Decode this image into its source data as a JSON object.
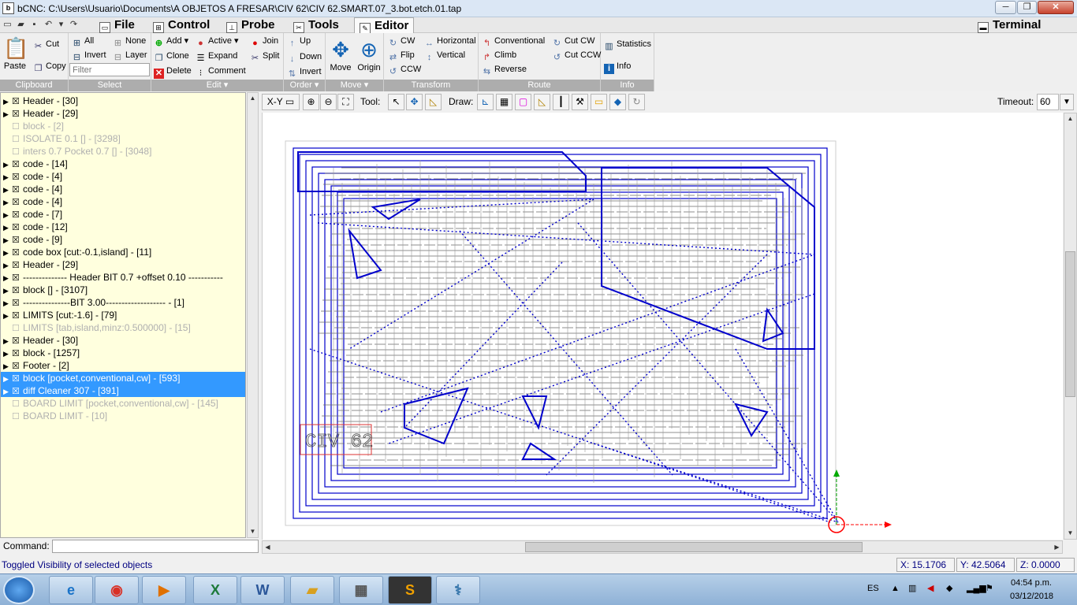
{
  "window": {
    "title": "bCNC: C:\\Users\\Usuario\\Documents\\A OBJETOS A FRESAR\\CIV 62\\CIV 62.SMART.07_3.bot.etch.01.tap",
    "app_icon": "bcnc-app-icon",
    "minimize": "─",
    "maximize": "❐",
    "close": "✕"
  },
  "menu": {
    "tabs": [
      {
        "label": "File",
        "icon": "file-icon"
      },
      {
        "label": "Control",
        "icon": "control-icon"
      },
      {
        "label": "Probe",
        "icon": "probe-icon"
      },
      {
        "label": "Tools",
        "icon": "tools-icon"
      },
      {
        "label": "Editor",
        "icon": "editor-icon"
      }
    ],
    "terminal": "Terminal"
  },
  "ribbon": {
    "clipboard": {
      "label": "Clipboard",
      "paste": "Paste",
      "cut": "Cut",
      "copy": "Copy"
    },
    "select": {
      "label": "Select",
      "all": "All",
      "none": "None",
      "invert": "Invert",
      "layer": "Layer",
      "filter_placeholder": "Filter"
    },
    "edit": {
      "label": "Edit",
      "add": "Add",
      "active": "Active",
      "join": "Join",
      "clone": "Clone",
      "expand": "Expand",
      "split": "Split",
      "delete": "Delete",
      "comment": "Comment"
    },
    "order": {
      "label": "Order",
      "up": "Up",
      "down": "Down",
      "invert": "Invert"
    },
    "move": {
      "label": "Move",
      "move": "Move",
      "origin": "Origin"
    },
    "transform": {
      "label": "Transform",
      "cw": "CW",
      "horizontal": "Horizontal",
      "flip": "Flip",
      "vertical": "Vertical",
      "ccw": "CCW"
    },
    "route": {
      "label": "Route",
      "conventional": "Conventional",
      "cut_cw": "Cut CW",
      "climb": "Climb",
      "cut_ccw": "Cut CCW",
      "reverse": "Reverse"
    },
    "info": {
      "label": "Info",
      "statistics": "Statistics",
      "info": "Info"
    }
  },
  "tree": [
    {
      "text": "Header - [30]",
      "enabled": true,
      "selected": false
    },
    {
      "text": "Header - [29]",
      "enabled": true,
      "selected": false
    },
    {
      "text": "block - [2]",
      "enabled": false,
      "selected": false
    },
    {
      "text": "ISOLATE 0.1 [] - [3298]",
      "enabled": false,
      "selected": false
    },
    {
      "text": "inters 0.7 Pocket 0.7 [] - [3048]",
      "enabled": false,
      "selected": false
    },
    {
      "text": "code - [14]",
      "enabled": true,
      "selected": false
    },
    {
      "text": "code - [4]",
      "enabled": true,
      "selected": false
    },
    {
      "text": "code - [4]",
      "enabled": true,
      "selected": false
    },
    {
      "text": "code - [4]",
      "enabled": true,
      "selected": false
    },
    {
      "text": "code - [7]",
      "enabled": true,
      "selected": false
    },
    {
      "text": "code - [12]",
      "enabled": true,
      "selected": false
    },
    {
      "text": "code - [9]",
      "enabled": true,
      "selected": false
    },
    {
      "text": "code box [cut:-0.1,island] - [11]",
      "enabled": true,
      "selected": false
    },
    {
      "text": "Header - [29]",
      "enabled": true,
      "selected": false
    },
    {
      "text": "-------------- Header BIT 0.7 +offset 0.10 -----------",
      "enabled": true,
      "selected": false
    },
    {
      "text": "block [] - [3107]",
      "enabled": true,
      "selected": false
    },
    {
      "text": "---------------BIT 3.00------------------- - [1]",
      "enabled": true,
      "selected": false
    },
    {
      "text": "LIMITS [cut:-1.6] - [79]",
      "enabled": true,
      "selected": false
    },
    {
      "text": "LIMITS [tab,island,minz:0.500000] - [15]",
      "enabled": false,
      "selected": false
    },
    {
      "text": "Header - [30]",
      "enabled": true,
      "selected": false
    },
    {
      "text": "block - [1257]",
      "enabled": true,
      "selected": false
    },
    {
      "text": "Footer - [2]",
      "enabled": true,
      "selected": false
    },
    {
      "text": "block [pocket,conventional,cw] - [593]",
      "enabled": true,
      "selected": true
    },
    {
      "text": "diff Cleaner 307 - [391]",
      "enabled": true,
      "selected": true
    },
    {
      "text": "BOARD LIMIT [pocket,conventional,cw] - [145]",
      "enabled": false,
      "selected": false
    },
    {
      "text": "BOARD LIMIT - [10]",
      "enabled": false,
      "selected": false
    }
  ],
  "command": {
    "label": "Command:",
    "value": ""
  },
  "status": {
    "message": "Toggled Visibility of selected objects",
    "x": "X: 15.1706",
    "y": "Y: 42.5064",
    "z": "Z: 0.0000"
  },
  "canvas_toolbar": {
    "view": "X-Y",
    "tool_label": "Tool:",
    "draw_label": "Draw:",
    "timeout_label": "Timeout:",
    "timeout_value": "60"
  },
  "canvas": {
    "board_label": "CIV 62",
    "colors": {
      "selected_path": "#0000cc",
      "traces": "#6a6a6a",
      "axis_x": "#ff0000",
      "axis_y": "#00aa00"
    }
  },
  "taskbar": {
    "lang": "ES",
    "time": "04:54 p.m.",
    "date": "03/12/2018"
  }
}
